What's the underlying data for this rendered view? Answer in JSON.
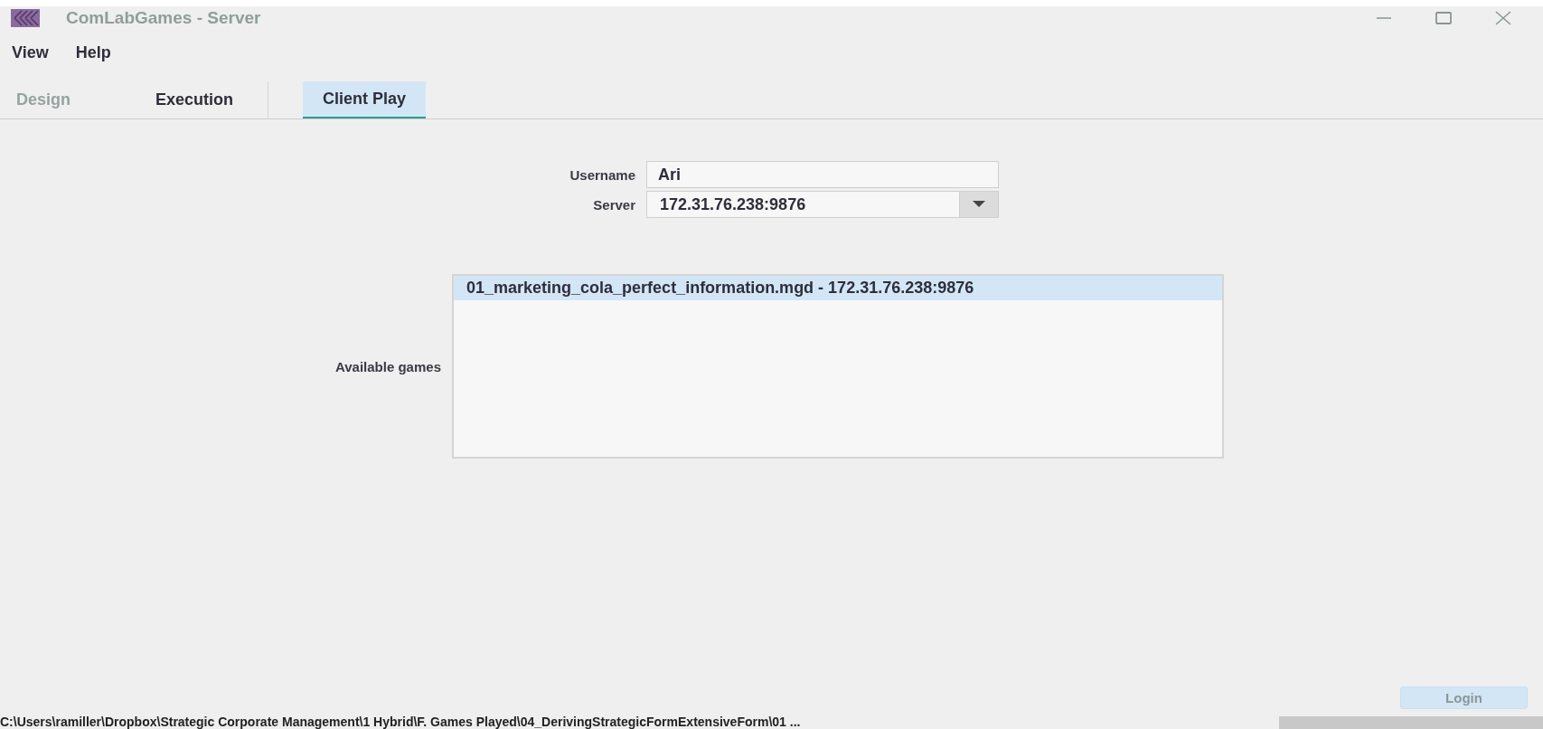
{
  "window": {
    "title": "ComLabGames - Server"
  },
  "menu": [
    "View",
    "Help"
  ],
  "tabs": [
    {
      "label": "Design",
      "selected": false,
      "disabled": true
    },
    {
      "label": "Execution",
      "selected": false,
      "disabled": false
    },
    {
      "label": "Client Play",
      "selected": true,
      "disabled": false
    }
  ],
  "form": {
    "username_label": "Username",
    "username": "Ari",
    "server_label": "Server",
    "server": "172.31.76.238:9876",
    "games_label": "Available games",
    "games": [
      {
        "label": "01_marketing_cola_perfect_information.mgd - 172.31.76.238:9876",
        "selected": true
      }
    ]
  },
  "login_button": {
    "label": "Login",
    "disabled": true
  },
  "status_bar": {
    "path": "C:\\Users\\ramiller\\Dropbox\\Strategic Corporate Management\\1 Hybrid\\F. Games Played\\04_DerivingStrategicFormExtensiveForm\\01 ..."
  }
}
